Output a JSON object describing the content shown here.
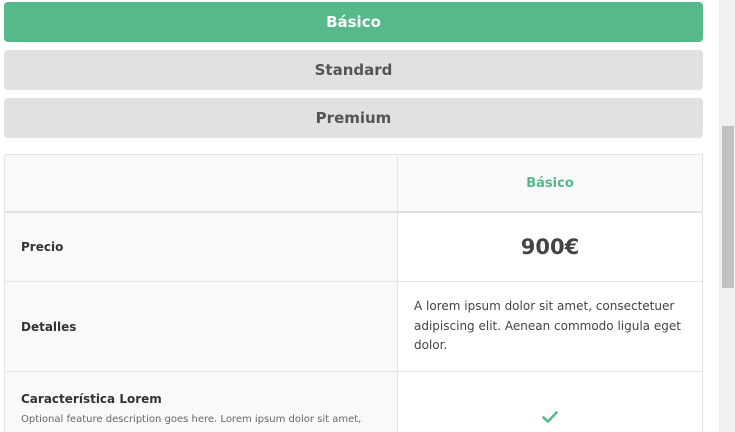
{
  "plans": {
    "tabs": [
      {
        "label": "Básico",
        "active": true
      },
      {
        "label": "Standard",
        "active": false
      },
      {
        "label": "Premium",
        "active": false
      }
    ]
  },
  "table": {
    "header": {
      "plan": "Básico"
    },
    "price": {
      "label": "Precio",
      "value": "900€"
    },
    "details": {
      "label": "Detalles",
      "value": "A lorem ipsum dolor sit amet, consectetuer adipiscing elit. Aenean commodo ligula eget dolor."
    },
    "feature": {
      "title": "Característica Lorem",
      "description": "Optional feature description goes here. Lorem ipsum dolor sit amet,",
      "included_icon": "check-icon"
    }
  },
  "colors": {
    "accent": "#55b98a",
    "tab_inactive": "#e1e1e1",
    "row_label_bg": "#f9f9f9"
  }
}
